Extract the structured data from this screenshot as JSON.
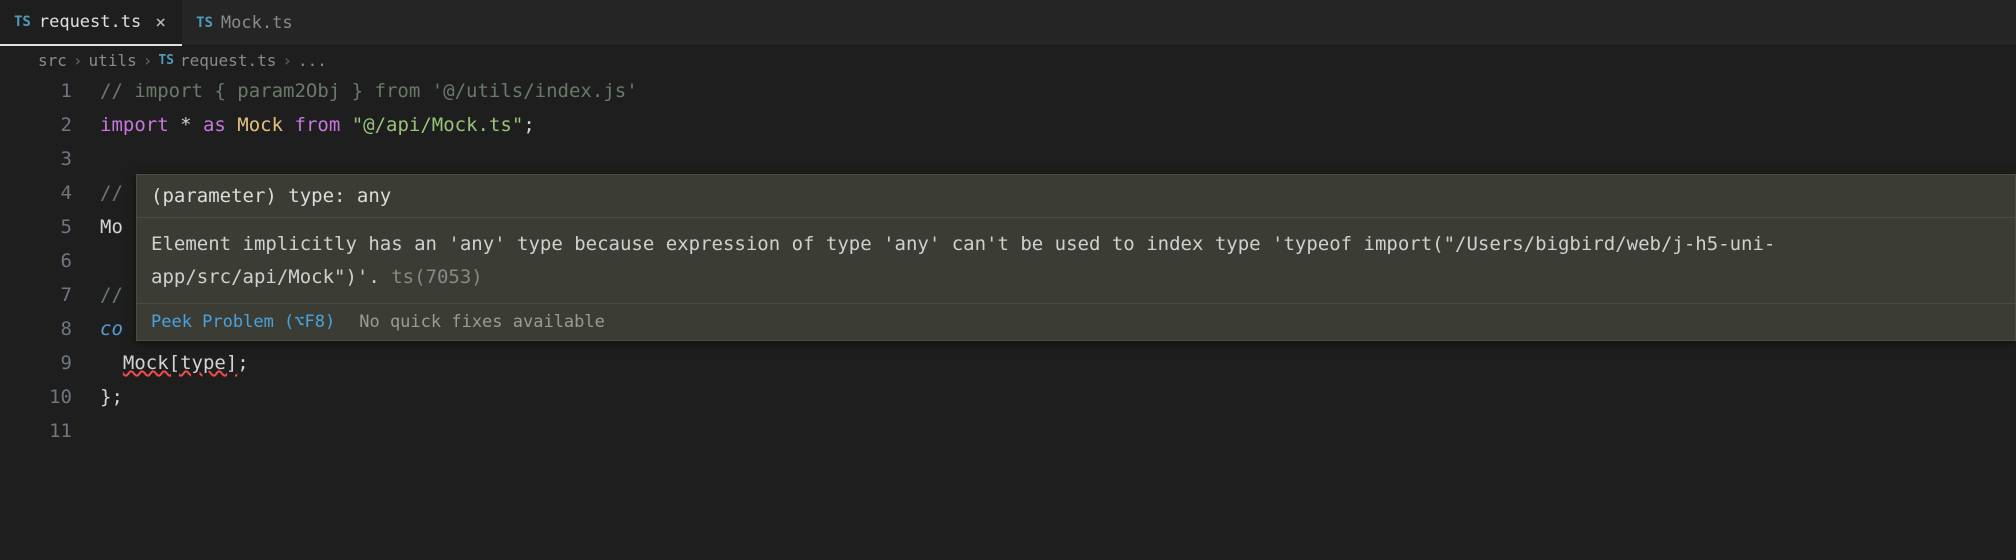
{
  "tabs": [
    {
      "badge": "TS",
      "label": "request.ts",
      "active": true
    },
    {
      "badge": "TS",
      "label": "Mock.ts",
      "active": false
    }
  ],
  "breadcrumbs": {
    "seg0": "src",
    "seg1": "utils",
    "badge": "TS",
    "seg2": "request.ts",
    "tail": "..."
  },
  "lines": {
    "n1": "1",
    "n2": "2",
    "n3": "3",
    "n4": "4",
    "n5": "5",
    "n6": "6",
    "n7": "7",
    "n8": "8",
    "n9": "9",
    "n10": "10",
    "n11": "11"
  },
  "code": {
    "l1_comment": "// import { param2Obj } from '@/utils/index.js'",
    "l2_import": "import",
    "l2_star": " * ",
    "l2_as": "as",
    "l2_mock": " Mock ",
    "l2_from": "from",
    "l2_sp": " ",
    "l2_str": "\"@/api/Mock.ts\"",
    "l2_semi": ";",
    "l4_prefix": "//",
    "l5_prefix": "Mo",
    "l7_prefix": "//",
    "l8_prefix": "co",
    "l9_indent": "  ",
    "l9_expr": "Mock[type]",
    "l9_semi": ";",
    "l10": "};"
  },
  "hover": {
    "head": "(parameter) type: any",
    "body_text": "Element implicitly has an 'any' type because expression of type 'any' can't be used to index type 'typeof import(\"/Users/bigbird/web/j-h5-uni-app/src/api/Mock\")'.",
    "body_code": " ts(7053)",
    "peek_label": "Peek Problem (⌥F8)",
    "nofix_label": "No quick fixes available"
  }
}
